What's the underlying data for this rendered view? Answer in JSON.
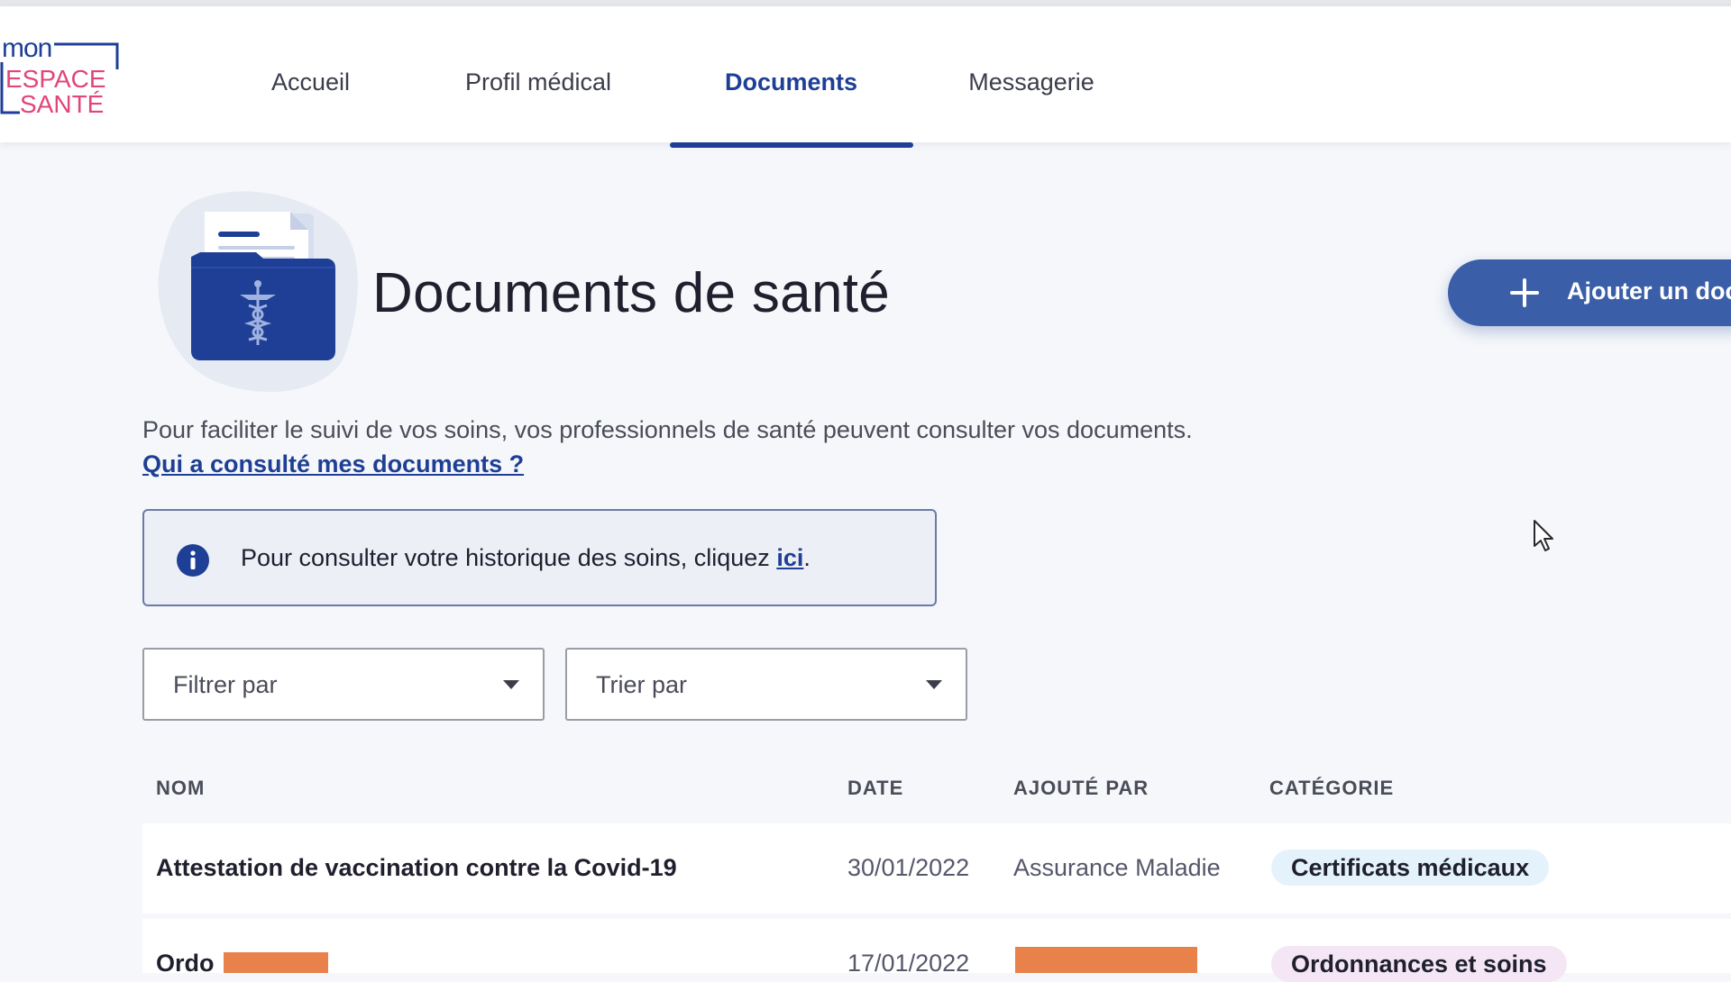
{
  "logo": {
    "alt": "MON ESPACE SANTÉ"
  },
  "nav": {
    "items": [
      {
        "label": "Accueil",
        "active": false
      },
      {
        "label": "Profil médical",
        "active": false
      },
      {
        "label": "Documents",
        "active": true
      },
      {
        "label": "Messagerie",
        "active": false
      }
    ]
  },
  "page": {
    "title": "Documents de santé",
    "add_button_label": "Ajouter un doc",
    "intro_text": "Pour faciliter le suivi de vos soins, vos professionnels de santé peuvent consulter vos documents.",
    "intro_link": "Qui a consulté mes documents ?"
  },
  "info_box": {
    "text": "Pour consulter votre historique des soins, cliquez ",
    "link": "ici",
    "suffix": "."
  },
  "filters": {
    "filter_label": "Filtrer par",
    "sort_label": "Trier par"
  },
  "table": {
    "columns": [
      "NOM",
      "DATE",
      "AJOUTÉ PAR",
      "CATÉGORIE"
    ],
    "rows": [
      {
        "name": "Attestation de vaccination contre la Covid-19",
        "date": "30/01/2022",
        "added_by": "Assurance Maladie",
        "category": "Certificats médicaux"
      },
      {
        "name": "Ordo",
        "date": "17/01/2022",
        "added_by": "",
        "category": "Ordonnances et soins"
      }
    ]
  },
  "colors": {
    "brand_blue": "#1e3f95",
    "button_blue": "#3a5fa8",
    "logo_pink": "#e0457b",
    "redaction": "#e8824a"
  },
  "icons": [
    "document-folder-icon",
    "plus-icon",
    "info-icon",
    "caret-down-icon",
    "mouse-cursor-icon"
  ]
}
